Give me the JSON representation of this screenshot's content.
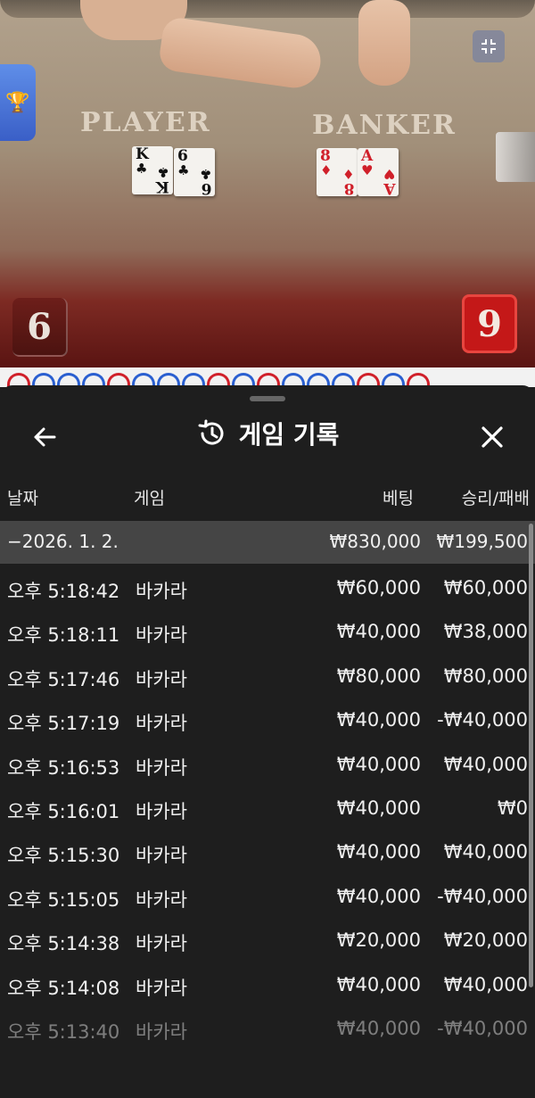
{
  "table": {
    "player_label": "PLAYER",
    "banker_label": "BANKER",
    "player_cards": [
      {
        "rank": "K",
        "suit": "♣",
        "color": "black"
      },
      {
        "rank": "6",
        "suit": "♣",
        "color": "black"
      }
    ],
    "banker_cards": [
      {
        "rank": "8",
        "suit": "♦",
        "color": "red"
      },
      {
        "rank": "A",
        "suit": "♥",
        "color": "red"
      }
    ],
    "player_score": "6",
    "banker_score": "9",
    "trophy_icon": "trophy-icon",
    "minimize_icon": "minimize-icon",
    "road_colors": [
      "#d0202a",
      "#2a5fd0",
      "#2a5fd0",
      "#2a5fd0",
      "#d0202a",
      "#2a5fd0",
      "#2a5fd0",
      "#2a5fd0",
      "#d0202a",
      "#2a5fd0",
      "#d0202a",
      "#2a5fd0",
      "#2a5fd0",
      "#2a5fd0",
      "#d0202a",
      "#2a5fd0",
      "#d0202a"
    ]
  },
  "sheet": {
    "title": "게임 기록",
    "back_icon": "arrow-left-icon",
    "history_icon": "history-icon",
    "close_icon": "close-icon"
  },
  "columns": {
    "date": "날짜",
    "game": "게임",
    "bet": "베팅",
    "result": "승리/패배"
  },
  "date_group": {
    "date": "−2026. 1. 2.",
    "total_bet": "₩830,000",
    "total_result": "₩199,500"
  },
  "rows": [
    {
      "time": "오후 5:18:42",
      "game": "바카라",
      "bet": "₩60,000",
      "result": "₩60,000"
    },
    {
      "time": "오후 5:18:11",
      "game": "바카라",
      "bet": "₩40,000",
      "result": "₩38,000"
    },
    {
      "time": "오후 5:17:46",
      "game": "바카라",
      "bet": "₩80,000",
      "result": "₩80,000"
    },
    {
      "time": "오후 5:17:19",
      "game": "바카라",
      "bet": "₩40,000",
      "result": "-₩40,000"
    },
    {
      "time": "오후 5:16:53",
      "game": "바카라",
      "bet": "₩40,000",
      "result": "₩40,000"
    },
    {
      "time": "오후 5:16:01",
      "game": "바카라",
      "bet": "₩40,000",
      "result": "₩0"
    },
    {
      "time": "오후 5:15:30",
      "game": "바카라",
      "bet": "₩40,000",
      "result": "₩40,000"
    },
    {
      "time": "오후 5:15:05",
      "game": "바카라",
      "bet": "₩40,000",
      "result": "-₩40,000"
    },
    {
      "time": "오후 5:14:38",
      "game": "바카라",
      "bet": "₩20,000",
      "result": "₩20,000"
    },
    {
      "time": "오후 5:14:08",
      "game": "바카라",
      "bet": "₩40,000",
      "result": "₩40,000"
    },
    {
      "time": "오후 5:13:40",
      "game": "바카라",
      "bet": "₩40,000",
      "result": "-₩40,000"
    }
  ]
}
